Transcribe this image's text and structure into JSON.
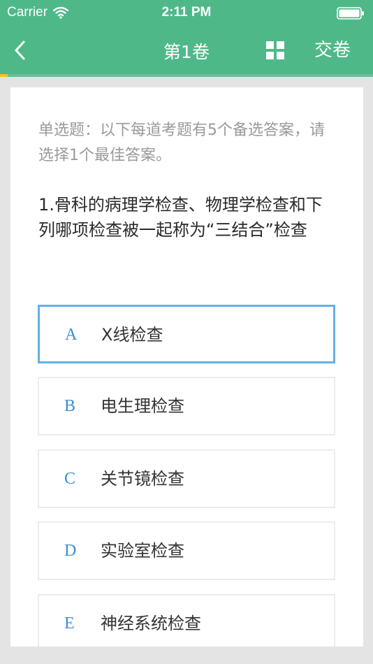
{
  "status_bar": {
    "carrier": "Carrier",
    "time": "2:11 PM"
  },
  "nav": {
    "title": "第1卷",
    "submit_label": "交卷",
    "icons": {
      "back": "chevron-left-icon",
      "grid": "grid-icon"
    }
  },
  "progress": {
    "fraction": 0.02
  },
  "question": {
    "instruction": "单选题：以下每道考题有5个备选答案，请选择1个最佳答案。",
    "text": "1.骨科的病理学检查、物理学检查和下列哪项检查被一起称为“三结合”检查",
    "selected": "A",
    "options": [
      {
        "letter": "A",
        "text": "X线检查"
      },
      {
        "letter": "B",
        "text": "电生理检查"
      },
      {
        "letter": "C",
        "text": "关节镜检查"
      },
      {
        "letter": "D",
        "text": "实验室检查"
      },
      {
        "letter": "E",
        "text": "神经系统检查"
      }
    ]
  },
  "colors": {
    "header": "#4fb889",
    "accent": "#f2c12e",
    "selected_border": "#62b2e6",
    "option_letter": "#3a8ed6"
  }
}
